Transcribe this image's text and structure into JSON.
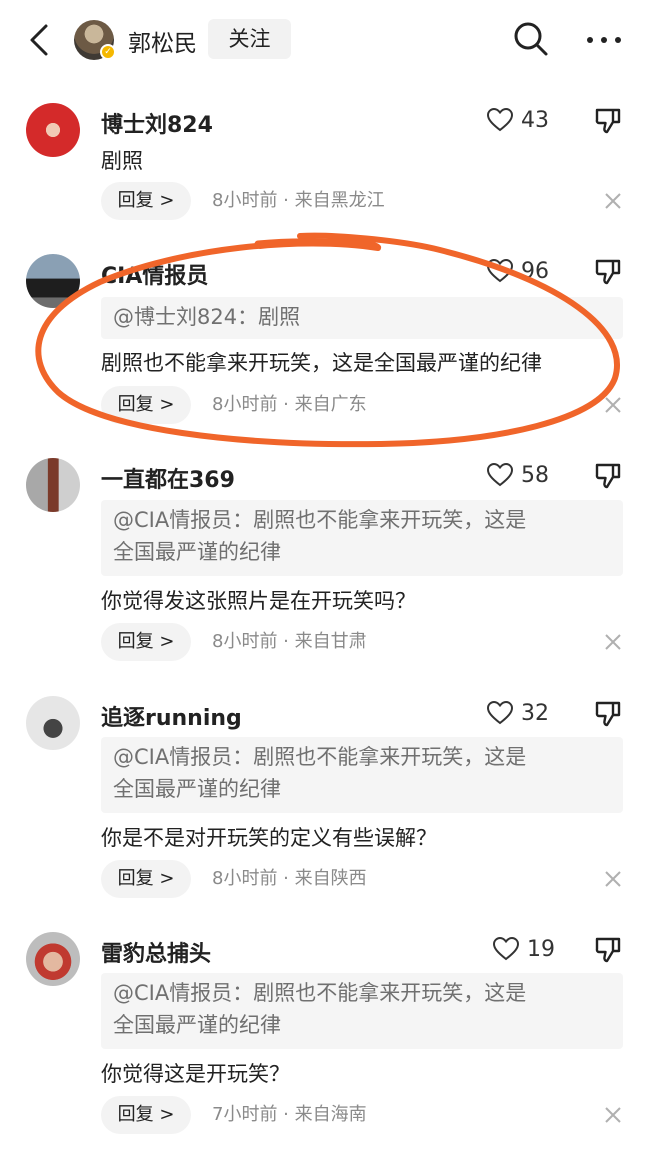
{
  "header": {
    "user_name": "郭松民",
    "follow_label": "关注",
    "icons": {
      "back": "chevron-left-icon",
      "search": "search-icon",
      "more": "more-dots-icon",
      "verify": "verified-badge-icon"
    }
  },
  "comments": [
    {
      "user": "博士刘824",
      "likes": "43",
      "quote": "",
      "text": "剧照",
      "reply_label": "回复 >",
      "meta": "8小时前 · 来自黑龙江"
    },
    {
      "user": "CIA情报员",
      "likes": "96",
      "quote": "@博士刘824：剧照",
      "text": "剧照也不能拿来开玩笑，这是全国最严谨的纪律",
      "reply_label": "回复 >",
      "meta": "8小时前 · 来自广东"
    },
    {
      "user": "一直都在369",
      "likes": "58",
      "quote_line1": "@CIA情报员：剧照也不能拿来开玩笑，这是",
      "quote_line2": "全国最严谨的纪律",
      "text": "你觉得发这张照片是在开玩笑吗？",
      "reply_label": "回复 >",
      "meta": "8小时前 · 来自甘肃"
    },
    {
      "user": "追逐running",
      "likes": "32",
      "quote_line1": "@CIA情报员：剧照也不能拿来开玩笑，这是",
      "quote_line2": "全国最严谨的纪律",
      "text": "你是不是对开玩笑的定义有些误解？",
      "reply_label": "回复 >",
      "meta": "8小时前 · 来自陕西"
    },
    {
      "user": "雷豹总捕头",
      "likes": "19",
      "quote_line1": "@CIA情报员：剧照也不能拿来开玩笑，这是",
      "quote_line2": "全国最严谨的纪律",
      "text": "你觉得这是开玩笑？",
      "reply_label": "回复 >",
      "meta": "7小时前 · 来自海南"
    }
  ],
  "colors": {
    "highlight_circle": "#f0652a",
    "meta_text": "#8a8a8a",
    "quote_bg": "#f5f5f5"
  }
}
